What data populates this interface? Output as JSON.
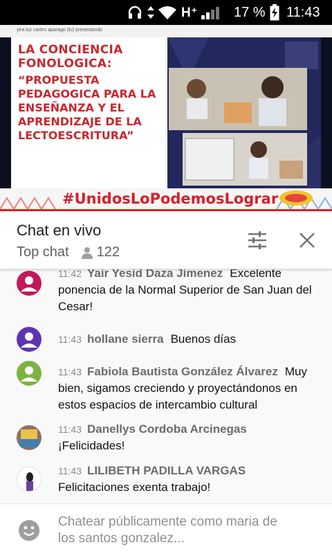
{
  "status_bar": {
    "network": "H⁺",
    "battery": "17 %",
    "time": "11:43"
  },
  "video": {
    "presenter_note": "yira luz castro aparago (tu) presentando",
    "slide_title": "LA CONCIENCIA FONOLOGICA:",
    "slide_subtitle": "“PROPUESTA PEDAGOGICA PARA LA ENSEÑANZA Y EL APRENDIZAJE DE LA LECTOESCRITURA”",
    "hashtag": "#UnidosLoPodemosLograr"
  },
  "chat": {
    "title": "Chat en vivo",
    "mode": "Top chat",
    "viewers": "122",
    "messages": [
      {
        "time": "11:42",
        "author": "Yair Yesid Daza Jimenez",
        "text": "Excelente ponencia de la Normal Superior de San Juan del Cesar!",
        "avatar_color": "#c2185b"
      },
      {
        "time": "11:43",
        "author": "hollane sierra",
        "text": "Buenos días",
        "avatar_color": "#5e35b1"
      },
      {
        "time": "11:43",
        "author": "Fabiola Bautista González Álvarez",
        "text": "Muy bien, sigamos creciendo y proyectándonos en estos espacios de intercambio cultural",
        "avatar_color": "#7cb342"
      },
      {
        "time": "11:43",
        "author": "Danellys Cordoba Arcinegas",
        "text": "¡Felicidades!",
        "avatar_color": "#8d6e63"
      },
      {
        "time": "11:43",
        "author": "LILIBETH PADILLA VARGAS",
        "text": "Felicitaciones exenta trabajo!",
        "avatar_color": "#ffffff"
      }
    ]
  },
  "input": {
    "placeholder": "Chatear públicamente como maria de los santos gonzalez..."
  }
}
